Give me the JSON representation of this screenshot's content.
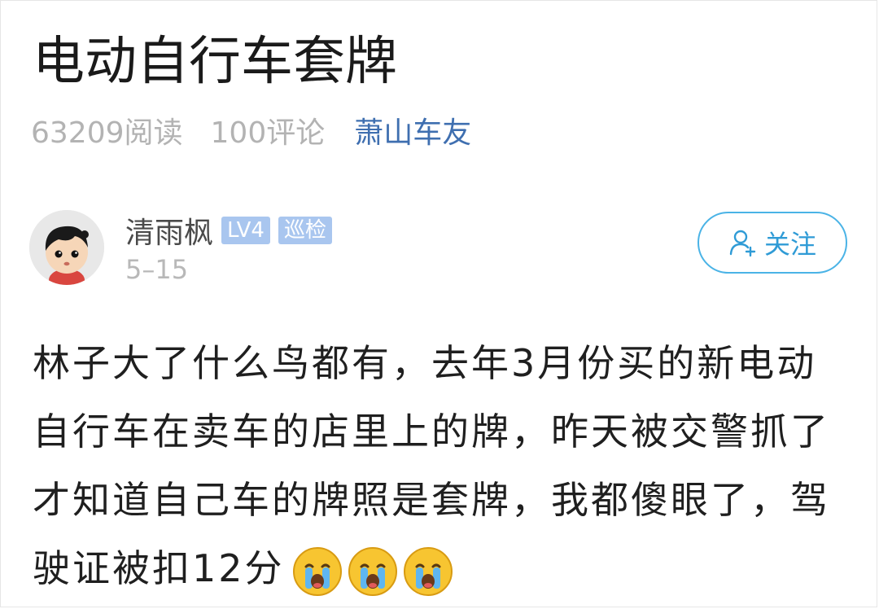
{
  "post": {
    "title": "电动自行车套牌",
    "reads": "63209阅读",
    "comments": "100评论",
    "forum": "萧山车友"
  },
  "author": {
    "name": "清雨枫",
    "level_badge": "LV4",
    "role_badge": "巡检",
    "date": "5–15",
    "avatar_icon": "cartoon-boy-avatar"
  },
  "follow_button": {
    "label": "关注",
    "icon": "add-user-icon"
  },
  "body": {
    "text": "林子大了什么鸟都有，去年3月份买的新电动自行车在卖车的店里上的牌，昨天被交警抓了才知道自己车的牌照是套牌，我都傻眼了，驾驶证被扣12分",
    "emojis": [
      "crying-face-icon",
      "crying-face-icon",
      "crying-face-icon"
    ]
  },
  "colors": {
    "accent_blue": "#4ab3e6",
    "forum_link": "#3f6fb0",
    "badge_bg": "#a9c6ef",
    "meta_gray": "#b3b3b3"
  }
}
